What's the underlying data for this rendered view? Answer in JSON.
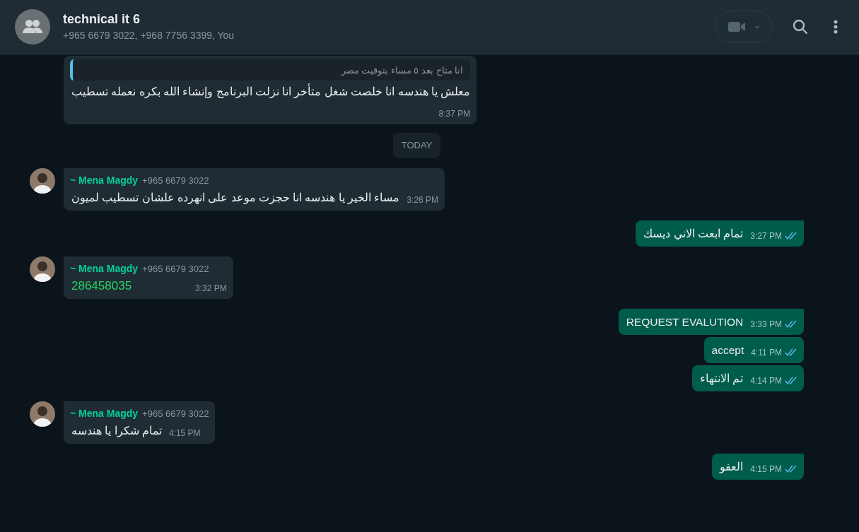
{
  "header": {
    "title": "technical it 6",
    "subtitle": "+965 6679 3022, +968 7756 3399, You"
  },
  "messages": [
    {
      "kind": "text",
      "outgoing": false,
      "quote": "انا متاح بعد ٥ مساء بتوقيت مصر",
      "text": "معلش يا هندسه انا خلصت شغل متأخر انا نزلت البرنامج وإنشاء الله بكره نعمله تسطيب",
      "time": "8:37 PM"
    },
    {
      "kind": "date",
      "label": "TODAY"
    },
    {
      "kind": "text",
      "outgoing": false,
      "sender": "~ Mena Magdy",
      "phone": "+965 6679 3022",
      "text": "مساء الخير يا هندسه انا حجزت موعد على انهرده علشان تسطيب لميون",
      "time": "3:26 PM"
    },
    {
      "kind": "text",
      "outgoing": true,
      "text": "تمام ابعت الاني ديسك",
      "time": "3:27 PM",
      "read": true
    },
    {
      "kind": "link",
      "outgoing": false,
      "sender": "~ Mena Magdy",
      "phone": "+965 6679 3022",
      "text": "286458035",
      "time": "3:32 PM"
    },
    {
      "kind": "text",
      "outgoing": true,
      "text": "REQUEST EVALUTION",
      "time": "3:33 PM",
      "read": true
    },
    {
      "kind": "text",
      "outgoing": true,
      "text": "accept",
      "time": "4:11 PM",
      "read": true
    },
    {
      "kind": "text",
      "outgoing": true,
      "text": "تم الانتهاء",
      "time": "4:14 PM",
      "read": true
    },
    {
      "kind": "text",
      "outgoing": false,
      "sender": "~ Mena Magdy",
      "phone": "+965 6679 3022",
      "text": "تمام شكرا يا هندسه",
      "time": "4:15 PM"
    },
    {
      "kind": "text",
      "outgoing": true,
      "text": "العفو",
      "time": "4:15 PM",
      "read": true
    }
  ]
}
